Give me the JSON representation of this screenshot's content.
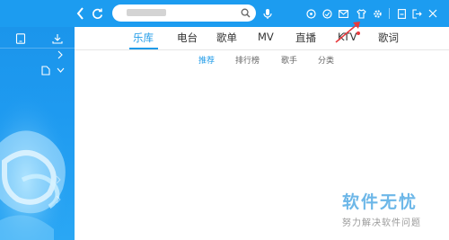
{
  "search": {
    "value": "",
    "placeholder": ""
  },
  "tabs": [
    {
      "label": "乐库",
      "active": true
    },
    {
      "label": "电台",
      "active": false
    },
    {
      "label": "歌单",
      "active": false
    },
    {
      "label": "MV",
      "active": false
    },
    {
      "label": "直播",
      "active": false
    },
    {
      "label": "KTV",
      "active": false
    },
    {
      "label": "歌词",
      "active": false
    }
  ],
  "subtabs": [
    {
      "label": "推荐",
      "active": true
    },
    {
      "label": "排行榜",
      "active": false
    },
    {
      "label": "歌手",
      "active": false
    },
    {
      "label": "分类",
      "active": false
    }
  ],
  "watermark": {
    "title": "软件无忧",
    "subtitle": "努力解决软件问题"
  },
  "colors": {
    "topbar": "#1c9cf0",
    "accent": "#1f9be8",
    "annotation_arrow": "#e8393d"
  },
  "icons": {
    "topbar": [
      "back-icon",
      "refresh-icon",
      "search-icon",
      "voice-icon",
      "game-icon",
      "message-icon",
      "mail-icon",
      "skin-icon",
      "settings-icon",
      "minimize-icon",
      "exit-icon",
      "close-icon"
    ],
    "sidebar": [
      "device-icon",
      "download-icon",
      "chevron-right-icon",
      "file-icon",
      "chevron-down-icon"
    ]
  }
}
